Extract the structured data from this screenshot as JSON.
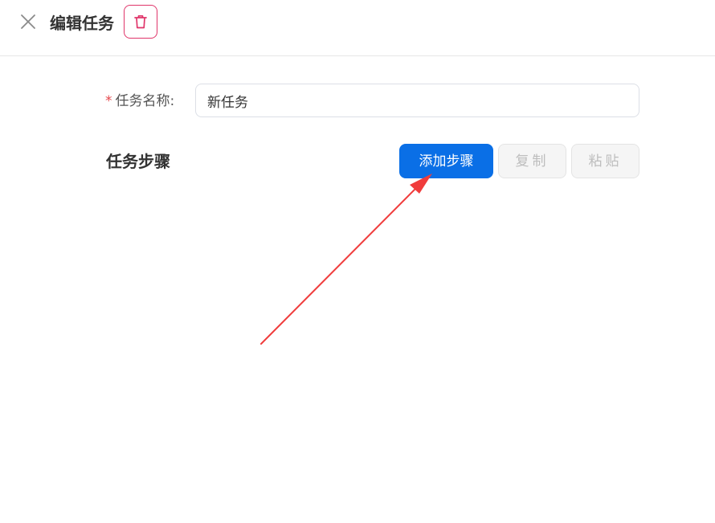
{
  "header": {
    "close_icon": "close-icon",
    "title": "编辑任务",
    "delete_icon": "trash-icon"
  },
  "form": {
    "name_label": "任务名称:",
    "required_mark": "*",
    "name_value": "新任务"
  },
  "steps": {
    "title": "任务步骤",
    "add_label": "添加步骤",
    "copy_label": "复制",
    "paste_label": "粘贴"
  },
  "colors": {
    "primary": "#0a6fe6",
    "danger": "#e0356a",
    "annotation_arrow": "#f03c3c"
  }
}
